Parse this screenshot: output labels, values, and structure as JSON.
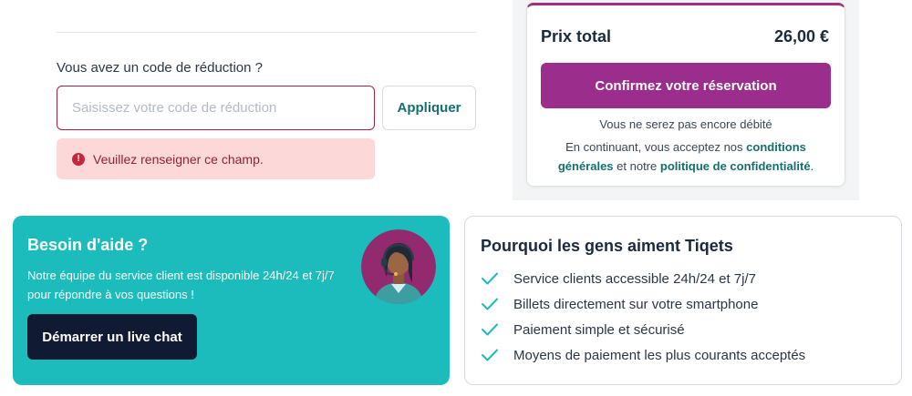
{
  "promo": {
    "label": "Vous avez un code de réduction ?",
    "input_value": "",
    "input_placeholder": "Saisissez votre code de réduction",
    "apply_label": "Appliquer",
    "error_icon": "!",
    "error_message": "Veuillez renseigner ce champ."
  },
  "summary": {
    "total_label": "Prix total",
    "total_value": "26,00 €",
    "confirm_label": "Confirmez votre réservation",
    "not_debited": "Vous ne serez pas encore débité",
    "terms_prefix": "En continuant, vous acceptez nos",
    "terms_link": "conditions générales",
    "terms_middle": "et notre",
    "privacy_link": "politique de confidentialité",
    "terms_suffix": "."
  },
  "help": {
    "title": "Besoin d'aide ?",
    "text": "Notre équipe du service client est disponible 24h/24 et 7j/7 pour répondre à vos questions !",
    "chat_label": "Démarrer un live chat",
    "avatar_icon": "support-agent-avatar"
  },
  "why": {
    "title": "Pourquoi les gens aiment Tiqets",
    "items": [
      "Service clients accessible 24h/24 et 7j/7",
      "Billets directement sur votre smartphone",
      "Paiement simple et sécurisé",
      "Moyens de paiement les plus courants acceptés"
    ]
  },
  "colors": {
    "brand_purple": "#9b2d8c",
    "teal": "#1cbcbd",
    "link_teal": "#13706c",
    "error_bg": "#fcd8d9",
    "error_red": "#c5283d",
    "navy": "#111a33"
  }
}
